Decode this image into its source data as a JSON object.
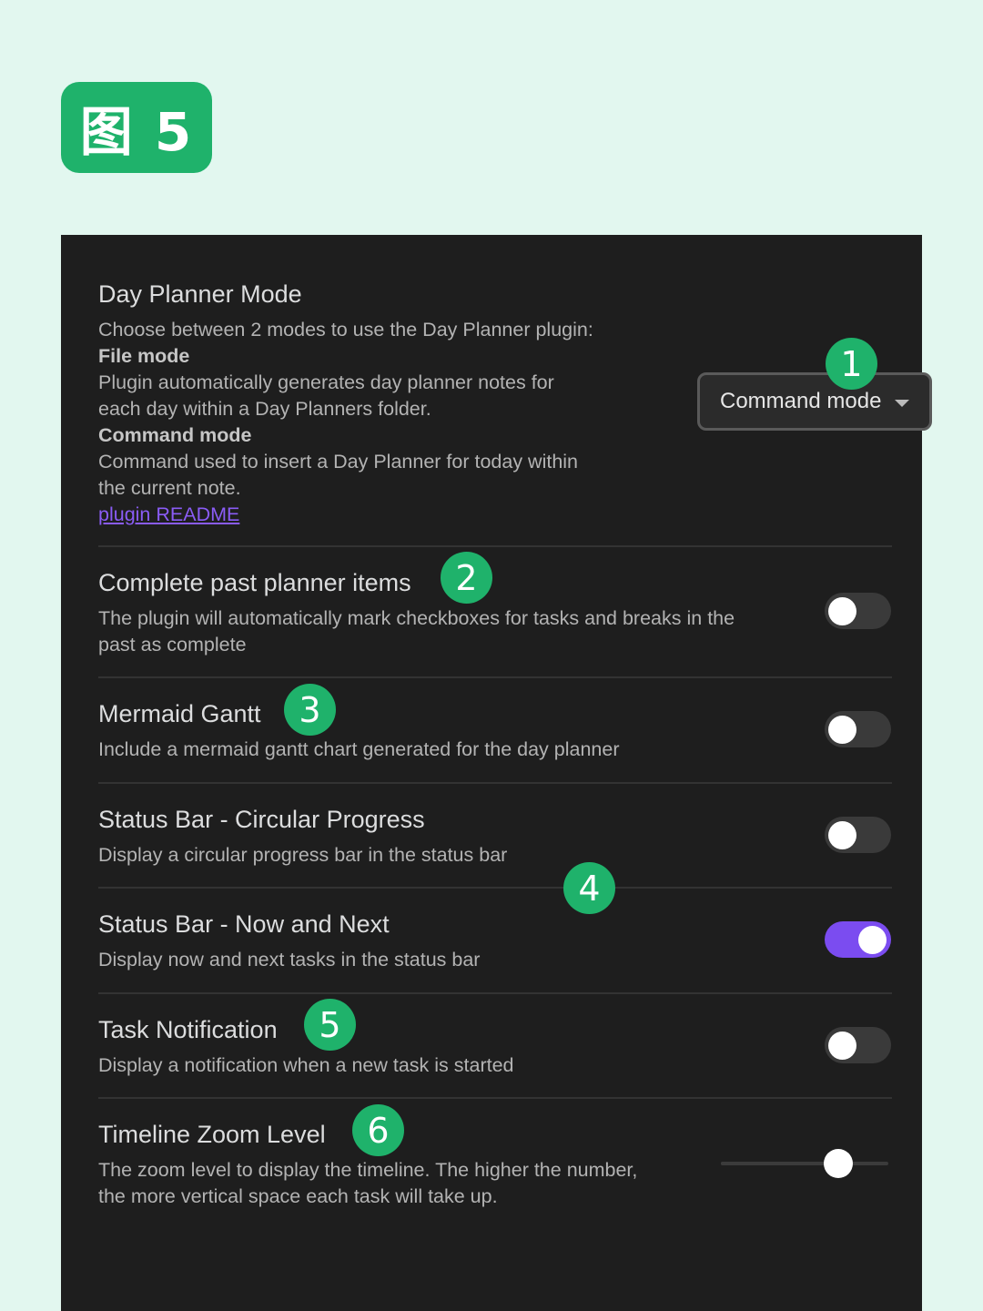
{
  "figure_label": "图 5",
  "settings": {
    "day_planner_mode": {
      "title": "Day Planner Mode",
      "desc_line1": "Choose between 2 modes to use the Day Planner plugin:",
      "file_mode_heading": "File mode",
      "file_mode_line1": "Plugin automatically generates day planner notes for",
      "file_mode_line2": "each day within a Day Planners folder.",
      "command_mode_heading": "Command mode",
      "command_mode_line1": "Command used to insert a Day Planner for today within",
      "command_mode_line2": "the current note.",
      "link_text": "plugin README",
      "dropdown_value": "Command mode"
    },
    "complete_past": {
      "title": "Complete past planner items",
      "desc_line1": "The plugin will automatically mark checkboxes for tasks and breaks in the",
      "desc_line2": "past as complete",
      "enabled": false
    },
    "mermaid_gantt": {
      "title": "Mermaid Gantt",
      "desc": "Include a mermaid gantt chart generated for the day planner",
      "enabled": false
    },
    "status_circular": {
      "title": "Status Bar - Circular Progress",
      "desc": "Display a circular progress bar in the status bar",
      "enabled": false
    },
    "status_now_next": {
      "title": "Status Bar - Now and Next",
      "desc": "Display now and next tasks in the status bar",
      "enabled": true
    },
    "task_notification": {
      "title": "Task Notification",
      "desc": "Display a notification when a new task is started",
      "enabled": false
    },
    "timeline_zoom": {
      "title": "Timeline Zoom Level",
      "desc_line1": "The zoom level to display the timeline. The higher the number,",
      "desc_line2": "the more vertical space each task will take up.",
      "slider_fraction": 0.7
    }
  },
  "badges": [
    "1",
    "2",
    "3",
    "4",
    "5",
    "6"
  ],
  "colors": {
    "background": "#e2f7ef",
    "badge": "#1fb26b",
    "panel": "#1e1e1e",
    "accent": "#7b4cf0",
    "link": "#8a5cf5"
  }
}
